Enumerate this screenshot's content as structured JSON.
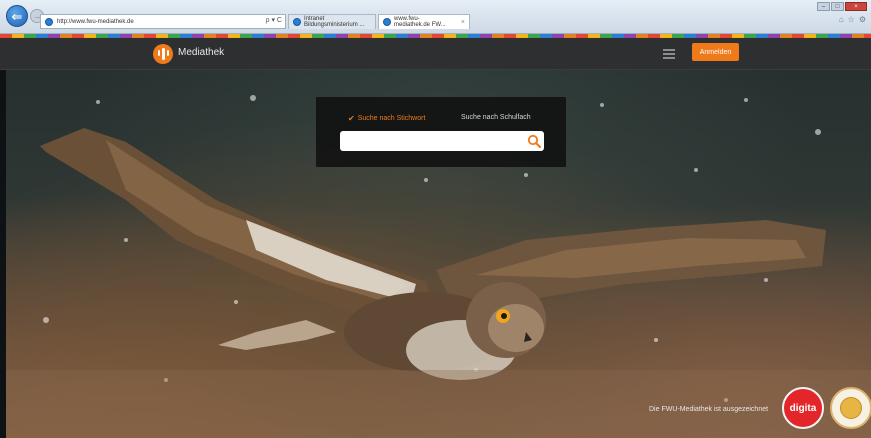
{
  "browser": {
    "address_url": "http://www.fwu-mediathek.de",
    "address_tools": "ρ ▾ C",
    "tabs": [
      {
        "label": "Intranet Bildungsministerium ...",
        "close": ""
      },
      {
        "label": "www.fwu-mediathek.de FW...",
        "close": "×"
      }
    ],
    "window_controls": {
      "minimize": "–",
      "maximize": "□",
      "close": "×"
    },
    "back_glyph": "⇐",
    "forward_glyph": "→",
    "icons": [
      "home-icon",
      "star-icon",
      "gear-icon"
    ]
  },
  "appbar": {
    "brand": "Mediathek",
    "login_label": "Anmelden",
    "accent": "#ee7a1a"
  },
  "search": {
    "tab_keyword": "Suche nach Stichwort",
    "tab_subject": "Suche nach Schulfach",
    "check_glyph": "✔",
    "input_value": "",
    "input_placeholder": ""
  },
  "footer": {
    "award_text": "Die FWU-Mediathek ist ausgezeichnet",
    "badge_text": "digita"
  }
}
